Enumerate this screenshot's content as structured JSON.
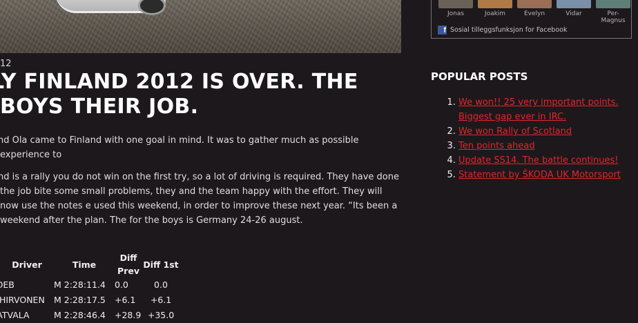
{
  "sidebar": {
    "facebook": {
      "friends": [
        {
          "name": "Jonas",
          "color": "#6b6257"
        },
        {
          "name": "Joakim",
          "color": "#b07a44"
        },
        {
          "name": "Evelyn",
          "color": "#9a6e55"
        },
        {
          "name": "Vidar",
          "color": "#7a8fa8"
        },
        {
          "name": "Per-Magnus",
          "color": "#5d7f78"
        }
      ],
      "plugin_label": "Sosial tilleggsfunksjon for Facebook"
    },
    "popular_posts": {
      "title": "POPULAR POSTS",
      "items": [
        "We won!! 25 very important points. Biggest gap ever in IRC.",
        "We won Rally of Scotland",
        "Ten points ahead",
        "Update SS14. The battle continues!",
        "Statement by ŠKODA UK Motorsport"
      ]
    }
  },
  "post": {
    "date": "12",
    "title": "LY FINLAND 2012 IS OVER. THE BOYS THEIR JOB.",
    "paragraph1": "and Ola came to Finland with one goal in mind. It was to gather much as possible experience to",
    "paragraph2": "and is a rally you do not win on the first try, so a lot of driving is required. They have done the job bite some small problems, they and the team happy with the effort. They will now use the notes e used this weekend, in order to improve these next year. “Its been a weekend after the plan. The for the boys is Germany 24-26 august.",
    "results": {
      "headers": {
        "driver": "Driver",
        "time": "Time",
        "diff_prev": "Diff Prev",
        "diff_first": "Diff 1st"
      },
      "rows": [
        {
          "driver": "LOEB",
          "time": "M 2:28:11.4",
          "diff_prev": "0.0",
          "diff_first": "0.0"
        },
        {
          "driver": "L HIRVONEN",
          "time": "M 2:28:17.5",
          "diff_prev": "+6.1",
          "diff_first": "+6.1"
        },
        {
          "driver": "LATVALA",
          "time": "M 2:28:46.4",
          "diff_prev": "+28.9",
          "diff_first": "+35.0"
        }
      ]
    }
  },
  "colors": {
    "background": "#1d181c",
    "link": "#e2262d",
    "facebook": "#3b5998"
  }
}
